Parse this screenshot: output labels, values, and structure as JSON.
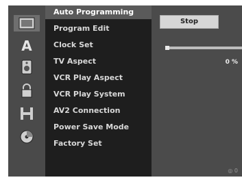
{
  "menu": {
    "items": [
      {
        "label": "Auto Programming",
        "selected": true
      },
      {
        "label": "Program Edit"
      },
      {
        "label": "Clock Set"
      },
      {
        "label": "TV Aspect"
      },
      {
        "label": "VCR Play Aspect"
      },
      {
        "label": "VCR Play System"
      },
      {
        "label": "AV2 Connection"
      },
      {
        "label": "Power Save Mode"
      },
      {
        "label": "Factory Set"
      }
    ]
  },
  "icons": [
    "disc-menu-icon",
    "language-icon",
    "audio-icon",
    "lock-icon",
    "film-icon",
    "disc-icon"
  ],
  "panel": {
    "stop_label": "Stop",
    "progress": 0.02,
    "percent_text": "0 %",
    "hint_text": "◎ 0"
  },
  "colors": {
    "screen_bg": "#3a3a3a",
    "menu_bg": "#1e1e1e",
    "selected_bg": "#5a5a5a"
  }
}
